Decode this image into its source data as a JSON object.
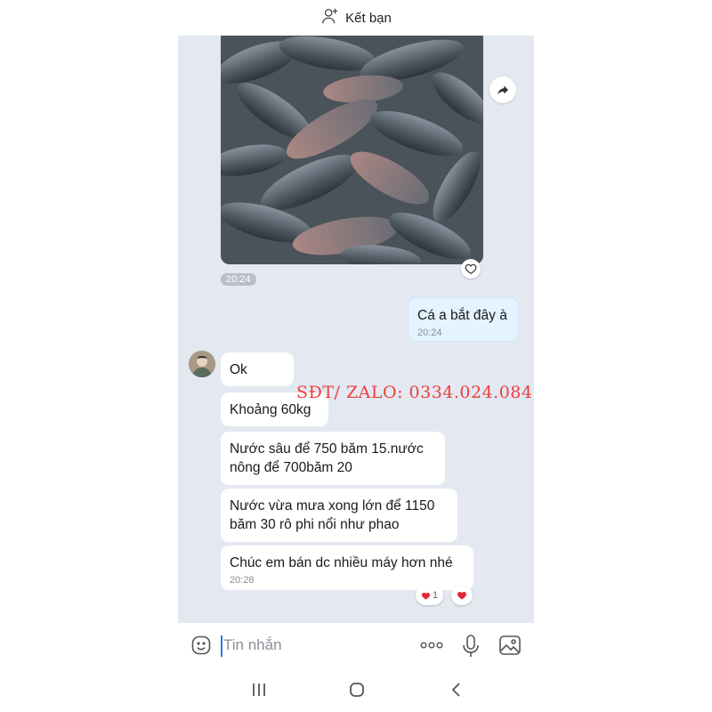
{
  "header": {
    "title": "Kết bạn",
    "icon": "add-friend-icon"
  },
  "image_message": {
    "time": "20:24",
    "share_icon": "share-icon",
    "react_icon": "heart-outline-icon"
  },
  "sent_message": {
    "text": "Cá a bắt đây à",
    "time": "20:24"
  },
  "received_messages": [
    {
      "text": "Ok"
    },
    {
      "text": "Khoảng 60kg"
    },
    {
      "line1": "Nước sâu để 750 băm 15.nước",
      "line2": "nông để 700băm 20"
    },
    {
      "line1": "Nước vừa mưa xong lớn để 1150",
      "line2": "băm 30 rô phi nổi như phao"
    },
    {
      "text": "Chúc em bán dc nhiều máy hơn nhé",
      "time": "20:28"
    }
  ],
  "reactions": {
    "count": "1",
    "icon": "heart-icon"
  },
  "watermark": "SĐT/ ZALO: 0334.024.084",
  "input": {
    "placeholder": "Tin nhắn"
  },
  "colors": {
    "chat_bg": "#e3e8f1",
    "sent_bubble": "#e3f3ff",
    "watermark": "#ef3e3e",
    "heart": "#e8243a"
  }
}
